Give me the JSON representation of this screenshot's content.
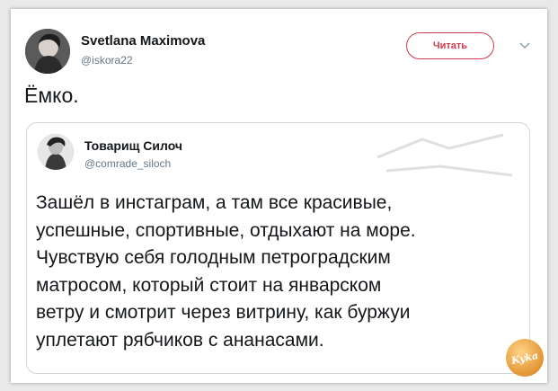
{
  "tweet": {
    "author_name": "Svetlana Maximova",
    "author_handle": "@iskora22",
    "follow_label": "Читать",
    "text": "Ёмко."
  },
  "quoted_tweet": {
    "author_name": "Товарищ Силоч",
    "author_handle": "@comrade_siloch",
    "lines": [
      "Зашёл в инстаграм, а там все красивые,",
      "успешные, спортивные, отдыхают на море.",
      "Чувствую себя голодным петроградским",
      "матросом, который стоит на январском",
      "ветру и смотрит через витрину, как буржуи",
      "уплетают рябчиков с ананасами."
    ]
  },
  "watermark": {
    "text": "Kyka"
  },
  "colors": {
    "follow_accent": "#d23a4c",
    "handle_gray": "#657786",
    "text": "#14171a"
  },
  "icons": {
    "menu_caret": "chevron-down-icon"
  }
}
